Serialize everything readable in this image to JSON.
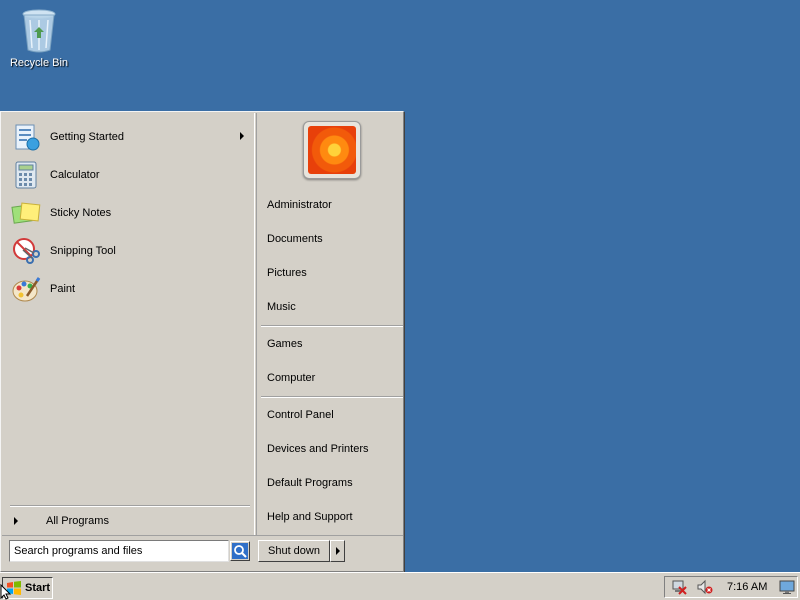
{
  "desktop": {
    "icons": [
      {
        "label": "Recycle Bin",
        "icon": "recycle-bin-icon"
      }
    ]
  },
  "start_menu": {
    "pinned_programs": [
      {
        "label": "Getting Started",
        "icon": "getting-started-icon",
        "has_submenu": true
      },
      {
        "label": "Calculator",
        "icon": "calculator-icon",
        "has_submenu": false
      },
      {
        "label": "Sticky Notes",
        "icon": "sticky-notes-icon",
        "has_submenu": false
      },
      {
        "label": "Snipping Tool",
        "icon": "snipping-tool-icon",
        "has_submenu": false
      },
      {
        "label": "Paint",
        "icon": "paint-icon",
        "has_submenu": false
      }
    ],
    "all_programs_label": "All Programs",
    "search": {
      "placeholder": "Search programs and files",
      "value": ""
    },
    "shutdown_label": "Shut down",
    "right_items": {
      "group1": [
        "Administrator",
        "Documents",
        "Pictures",
        "Music"
      ],
      "group2": [
        "Games",
        "Computer"
      ],
      "group3": [
        "Control Panel",
        "Devices and Printers",
        "Default Programs",
        "Help and Support"
      ]
    },
    "user_picture": "flower-avatar"
  },
  "taskbar": {
    "start_label": "Start",
    "clock": "7:16 AM",
    "tray_icons": [
      "network-disconnected-icon",
      "volume-muted-icon",
      "show-desktop-icon"
    ]
  },
  "colors": {
    "desktop_background": "#3a6ea5",
    "menu_background": "#d4d0c8"
  }
}
